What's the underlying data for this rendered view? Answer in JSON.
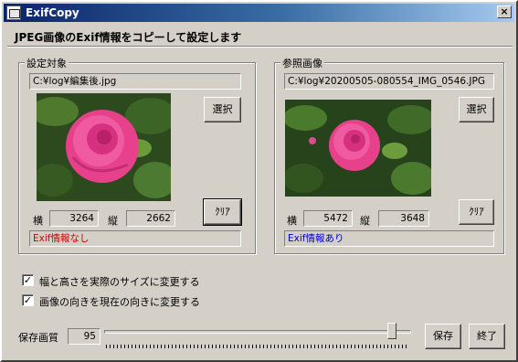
{
  "window": {
    "title": "ExifCopy",
    "close_label": "×"
  },
  "heading": "JPEG画像のExif情報をコピーして設定します",
  "target": {
    "group_title": "設定対象",
    "path": "C:¥log¥編集後.jpg",
    "select_label": "選択",
    "clear_label": "ｸﾘｱ",
    "width_label": "横",
    "width_value": "3264",
    "height_label": "縦",
    "height_value": "2662",
    "status": "Exif情報なし",
    "status_color": "#cc0000"
  },
  "reference": {
    "group_title": "参照画像",
    "path": "C:¥log¥20200505-080554_IMG_0546.JPG",
    "select_label": "選択",
    "clear_label": "ｸﾘｱ",
    "width_label": "横",
    "width_value": "5472",
    "height_label": "縦",
    "height_value": "3648",
    "status": "Exif情報あり",
    "status_color": "#0000cc"
  },
  "options": [
    {
      "label": "幅と高さを実際のサイズに変更する",
      "checked": true
    },
    {
      "label": "画像の向きを現在の向きに変更する",
      "checked": true
    }
  ],
  "quality": {
    "label": "保存画質",
    "value": "95",
    "fraction": 0.95
  },
  "buttons": {
    "save": "保存",
    "exit": "終了"
  },
  "icons": {
    "check": "✓"
  }
}
